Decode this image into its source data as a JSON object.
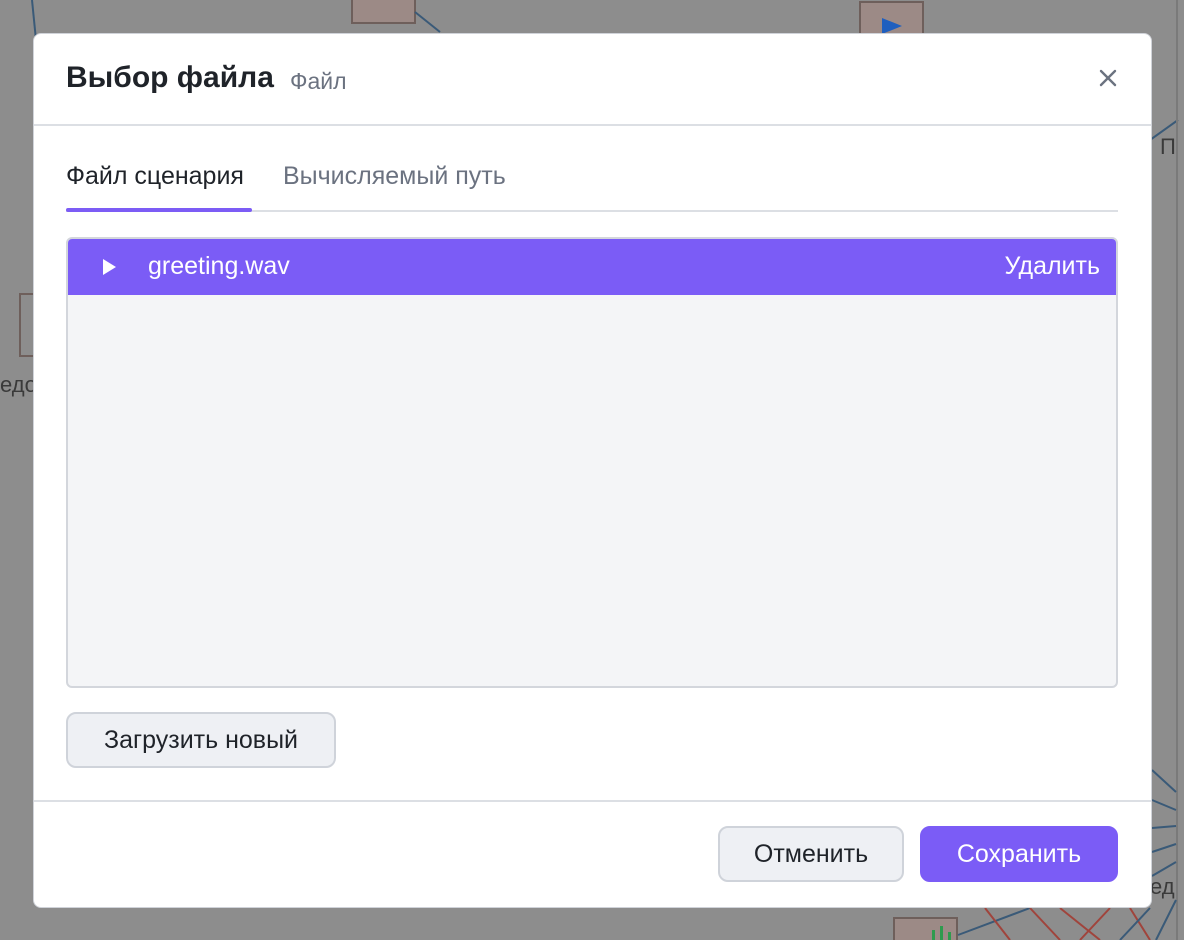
{
  "modal": {
    "title": "Выбор файла",
    "subtitle": "Файл"
  },
  "tabs": [
    {
      "label": "Файл сценария",
      "active": true
    },
    {
      "label": "Вычисляемый путь",
      "active": false
    }
  ],
  "file_list": {
    "items": [
      {
        "name": "greeting.wav",
        "selected": true,
        "delete_label": "Удалить"
      }
    ]
  },
  "actions": {
    "upload_label": "Загрузить новый",
    "cancel_label": "Отменить",
    "save_label": "Сохранить"
  },
  "background": {
    "fragments": [
      "П",
      "едо",
      "ед"
    ]
  },
  "colors": {
    "accent": "#7b5cf6",
    "overlay": "#8d8d8d",
    "list_bg": "#f4f5f7"
  }
}
